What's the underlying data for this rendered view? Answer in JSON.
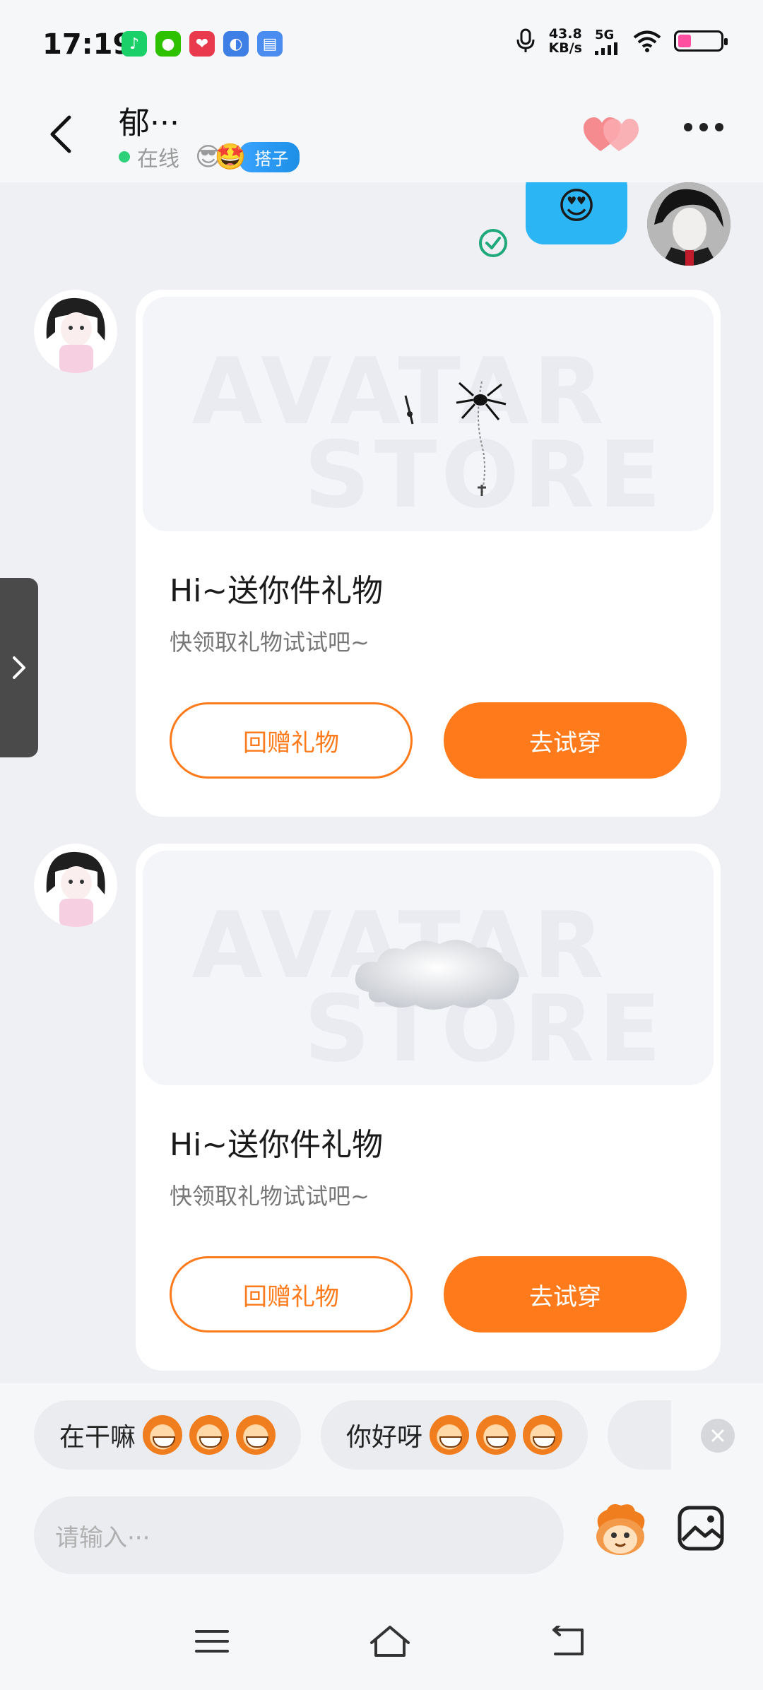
{
  "status_bar": {
    "time": "17:19",
    "speed_value": "43.8",
    "speed_unit": "KB/s",
    "network": "5G",
    "app_icons": [
      "music-app-icon",
      "wechat-icon",
      "shopping-app-icon",
      "browser-app-icon",
      "files-app-icon"
    ]
  },
  "header": {
    "title": "郁···",
    "status": "在线",
    "badge": "搭子"
  },
  "messages": {
    "sent_emoji": "😍",
    "gift_cards": [
      {
        "title": "Hi~送你件礼物",
        "subtitle": "快领取礼物试试吧~",
        "return_button": "回赠礼物",
        "try_button": "去试穿",
        "watermark_top": "AVATAR",
        "watermark_bottom": "STORE"
      },
      {
        "title": "Hi~送你件礼物",
        "subtitle": "快领取礼物试试吧~",
        "return_button": "回赠礼物",
        "try_button": "去试穿",
        "watermark_top": "AVATAR",
        "watermark_bottom": "STORE"
      }
    ]
  },
  "quick_replies": [
    {
      "text": "在干嘛"
    },
    {
      "text": "你好呀"
    }
  ],
  "input": {
    "placeholder": "请输入···"
  },
  "colors": {
    "accent": "#ff7a1a",
    "sent_bubble": "#2cb5f5",
    "online": "#2fd07a",
    "read_check": "#1fa97a"
  }
}
